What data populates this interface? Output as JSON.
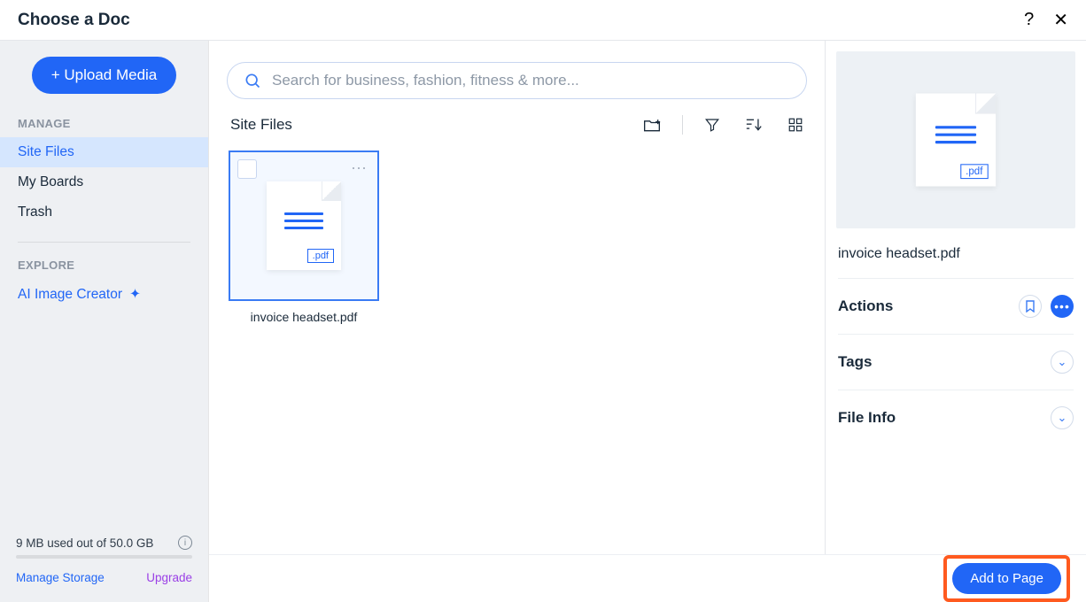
{
  "header": {
    "title": "Choose a Doc"
  },
  "sidebar": {
    "upload_label": "+ Upload Media",
    "manage_label": "MANAGE",
    "items": [
      {
        "label": "Site Files",
        "active": true
      },
      {
        "label": "My Boards",
        "active": false
      },
      {
        "label": "Trash",
        "active": false
      }
    ],
    "explore_label": "EXPLORE",
    "ai_label": "AI Image Creator",
    "storage_text": "9 MB used out of 50.0 GB",
    "manage_storage": "Manage Storage",
    "upgrade": "Upgrade"
  },
  "search": {
    "placeholder": "Search for business, fashion, fitness & more..."
  },
  "toolbar": {
    "title": "Site Files"
  },
  "files": [
    {
      "name": "invoice headset.pdf",
      "ext": ".pdf"
    }
  ],
  "details": {
    "filename": "invoice headset.pdf",
    "ext": ".pdf",
    "sections": {
      "actions": "Actions",
      "tags": "Tags",
      "file_info": "File Info"
    }
  },
  "footer": {
    "add_label": "Add to Page"
  }
}
